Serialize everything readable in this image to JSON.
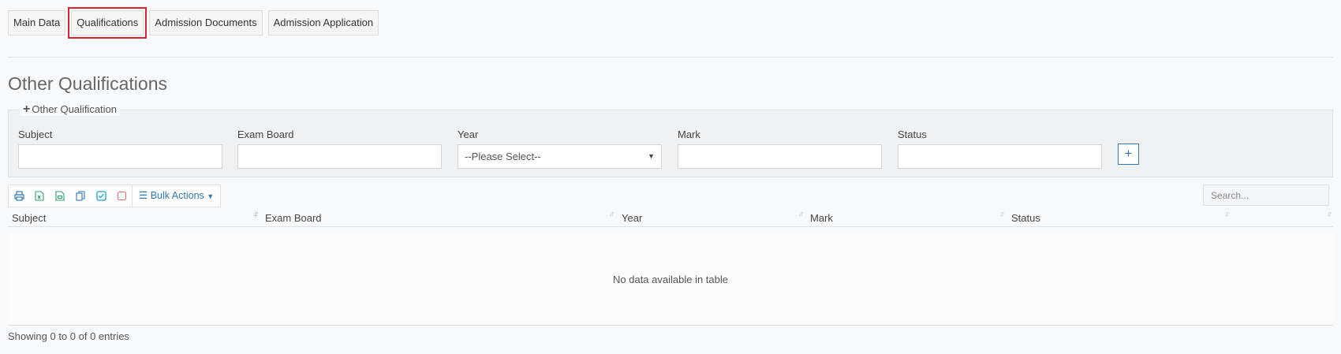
{
  "tabs": [
    {
      "label": "Main Data"
    },
    {
      "label": "Qualifications"
    },
    {
      "label": "Admission Documents"
    },
    {
      "label": "Admission Application"
    }
  ],
  "section": {
    "title": "Other Qualifications"
  },
  "form": {
    "legend": "Other Qualification",
    "subject_label": "Subject",
    "exam_board_label": "Exam Board",
    "year_label": "Year",
    "year_value": "--Please Select--",
    "mark_label": "Mark",
    "status_label": "Status",
    "add_button": "+"
  },
  "toolbar": {
    "icons": [
      "print-icon",
      "excel-icon",
      "csv-icon",
      "copy-icon",
      "select-all-icon",
      "deselect-icon"
    ],
    "bulk_actions": "Bulk Actions"
  },
  "search": {
    "placeholder": "Search..."
  },
  "table": {
    "columns": [
      "Subject",
      "Exam Board",
      "Year",
      "Mark",
      "Status"
    ],
    "empty_message": "No data available in table",
    "info": "Showing 0 to 0 of 0 entries"
  },
  "colors": {
    "accent": "#3478b4",
    "highlight": "#d9232d"
  }
}
